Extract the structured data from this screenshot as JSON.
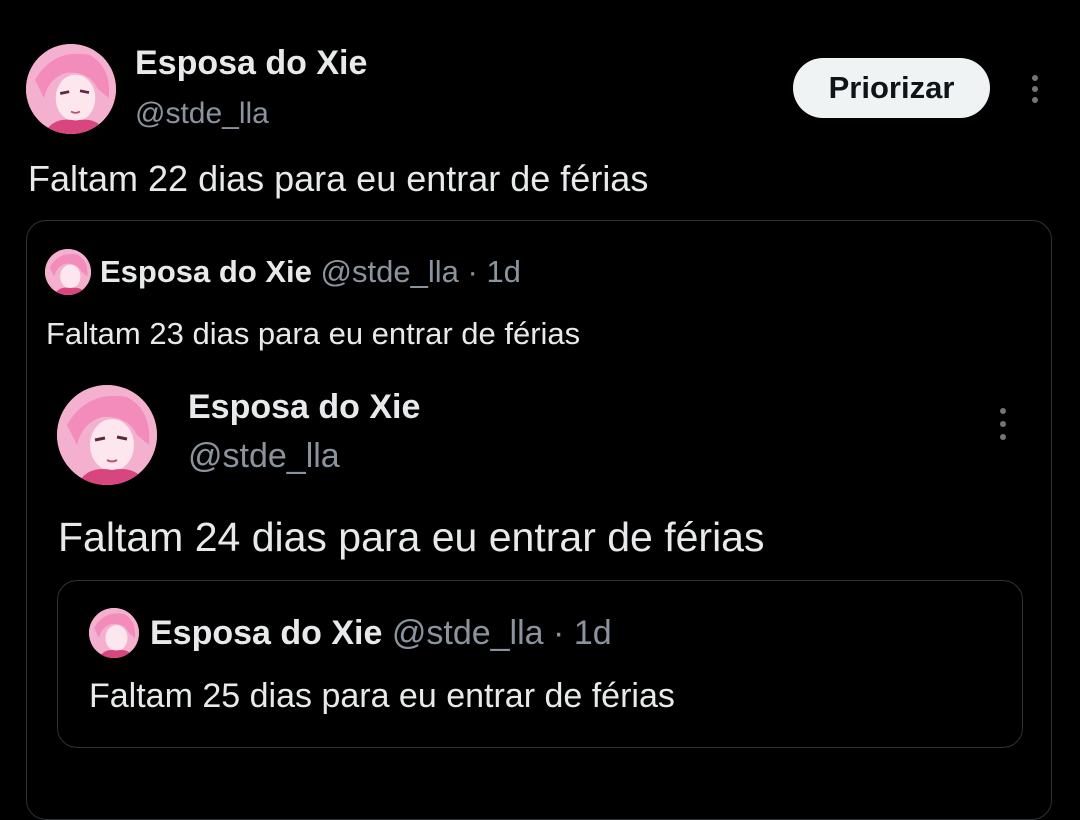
{
  "top_tweet": {
    "author_name": "Esposa do Xie",
    "author_handle": "@stde_lla",
    "prioritize_label": "Priorizar",
    "text": "Faltam 22 dias para eu entrar de férias"
  },
  "quote1": {
    "author_name": "Esposa do Xie",
    "author_handle": "@stde_lla",
    "separator": "·",
    "time": "1d",
    "text": "Faltam 23 dias para eu entrar de férias"
  },
  "embedded_tweet": {
    "author_name": "Esposa do Xie",
    "author_handle": "@stde_lla",
    "text": "Faltam 24 dias para eu entrar de férias"
  },
  "quote2": {
    "author_name": "Esposa do Xie",
    "author_handle": "@stde_lla",
    "separator": "·",
    "time": "1d",
    "text": "Faltam 25 dias para eu entrar de férias"
  },
  "colors": {
    "background": "#000000",
    "text_primary": "#e7e9ea",
    "text_secondary": "#8b949e",
    "border": "#2f3336",
    "button_bg": "#eff3f4",
    "avatar_pink": "#f3a4c8"
  },
  "icons": {
    "more": "more-vertical-icon",
    "avatar": "profile-avatar"
  }
}
